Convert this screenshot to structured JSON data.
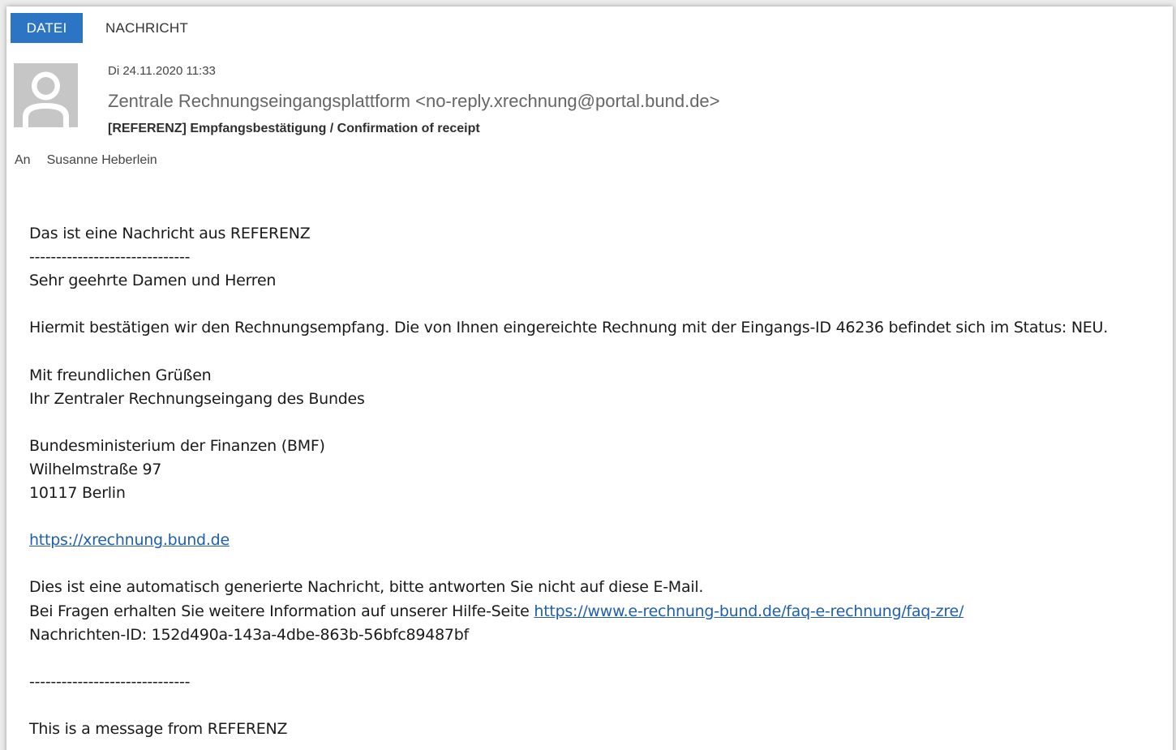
{
  "tabs": {
    "file": "DATEI",
    "message": "NACHRICHT"
  },
  "header": {
    "date": "Di 24.11.2020 11:33",
    "sender": "Zentrale Rechnungseingangsplattform <no-reply.xrechnung@portal.bund.de>",
    "subject": "[REFERENZ] Empfangsbestätigung / Confirmation of receipt",
    "to_label": "An",
    "to_name": "Susanne Heberlein",
    "avatar_icon": "person-silhouette-icon"
  },
  "body": {
    "intro": "Das ist eine Nachricht aus REFERENZ",
    "separator1": "------------------------------",
    "greeting": "Sehr geehrte Damen und Herren",
    "confirmation": "Hiermit bestätigen wir den Rechnungsempfang. Die von Ihnen eingereichte Rechnung mit der Eingangs-ID 46236 befindet sich im Status: NEU.",
    "closing": "Mit freundlichen Grüßen",
    "signature": "Ihr Zentraler Rechnungseingang des Bundes",
    "org": "Bundesministerium der Finanzen (BMF)",
    "street": "Wilhelmstraße 97",
    "city": "10117 Berlin",
    "website_link": "https://xrechnung.bund.de",
    "auto_notice": "Dies ist eine automatisch generierte Nachricht, bitte antworten Sie nicht auf diese E-Mail.",
    "help_prefix": "Bei Fragen erhalten Sie weitere Information auf unserer Hilfe-Seite ",
    "help_link": "https://www.e-rechnung-bund.de/faq-e-rechnung/faq-zre/",
    "message_id": "Nachrichten-ID: 152d490a-143a-4dbe-863b-56bfc89487bf",
    "separator2": "------------------------------",
    "english_intro": "This is a message from REFERENZ"
  },
  "colors": {
    "file_tab_bg": "#2b75c4",
    "link": "#1f5fae",
    "avatar_bg": "#c6c6c6"
  }
}
